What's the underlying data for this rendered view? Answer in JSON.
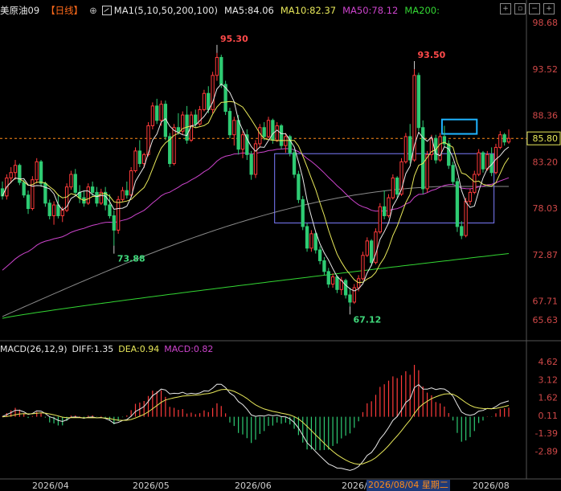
{
  "header": {
    "symbol": "美原油09",
    "period": "【日线】",
    "plus_icon": "plus-circle-icon",
    "ma_icon": "ma-settings-icon",
    "ma_config": "MA1(5,10,50,200,100)",
    "ma5": "MA5:84.06",
    "ma10": "MA10:82.37",
    "ma50": "MA50:78.12",
    "ma200": "MA200:"
  },
  "window_controls": [
    "+",
    "▫",
    "−",
    "+"
  ],
  "macd_header": {
    "name": "MACD(26,12,9)",
    "diff": "DIFF:1.35",
    "dea": "DEA:0.94",
    "macd": "MACD:0.82"
  },
  "colors": {
    "background": "#000000",
    "up": "#ff3a3a",
    "down": "#2ecb73",
    "ma5": "#e8e8e8",
    "ma10": "#e8e85a",
    "ma50": "#cc44cc",
    "ma100": "#8a8a8a",
    "ma200": "#33d633",
    "price_tag": "#e8e85a",
    "accent_orange": "#ff6a1a"
  },
  "chart_data": {
    "type": "candlestick",
    "price_axis": {
      "ticks": [
        "98.68",
        "93.52",
        "88.36",
        "83.20",
        "78.03",
        "72.87",
        "67.71",
        "65.63"
      ],
      "ylim": [
        65.63,
        98.68
      ]
    },
    "current_price": "85.80",
    "annotations": [
      {
        "label": "95.30",
        "value": 95.3,
        "kind": "high"
      },
      {
        "label": "73.88",
        "value": 73.88,
        "kind": "low"
      },
      {
        "label": "93.50",
        "value": 93.5,
        "kind": "high"
      },
      {
        "label": "67.12",
        "value": 67.12,
        "kind": "low"
      }
    ],
    "range_box": {
      "from": "2026/06/12",
      "to": "2026/08/21",
      "high": 84.1,
      "low": 76.4
    },
    "highlight_box": {
      "from": "2026/08/06",
      "to": "2026/08/17",
      "high": 87.9,
      "low": 86.3
    },
    "x_labels": [
      "2026/04",
      "2026/05",
      "2026/06",
      "2026/0",
      "2026/08"
    ],
    "cursor_label": "2026/08/04 星期二",
    "ma_series": [
      {
        "name": "MA5",
        "period": 5
      },
      {
        "name": "MA10",
        "period": 10
      },
      {
        "name": "MA50",
        "period": 50
      },
      {
        "name": "MA200",
        "period": 200
      },
      {
        "name": "MA100",
        "period": 100
      }
    ],
    "macd_axis": {
      "ticks": [
        "4.62",
        "3.12",
        "1.62",
        "0.11",
        "-1.39",
        "-2.89"
      ],
      "ylim": [
        -3.6,
        5.1
      ]
    },
    "start_date": "2026/03/16",
    "candles": [
      [
        80.2,
        81.0,
        79.0,
        79.4
      ],
      [
        79.4,
        81.8,
        79.0,
        81.4
      ],
      [
        81.4,
        82.6,
        80.8,
        82.0
      ],
      [
        82.0,
        83.4,
        81.2,
        82.8
      ],
      [
        82.8,
        83.0,
        80.6,
        80.9
      ],
      [
        80.9,
        81.2,
        79.2,
        79.5
      ],
      [
        79.5,
        80.0,
        77.4,
        78.0
      ],
      [
        78.0,
        81.6,
        77.8,
        81.2
      ],
      [
        81.2,
        83.6,
        80.8,
        83.2
      ],
      [
        83.2,
        83.4,
        80.4,
        80.8
      ],
      [
        80.8,
        81.0,
        78.2,
        78.6
      ],
      [
        78.6,
        79.0,
        76.8,
        77.2
      ],
      [
        77.2,
        78.8,
        76.2,
        78.4
      ],
      [
        78.4,
        79.6,
        76.9,
        77.2
      ],
      [
        77.2,
        78.2,
        76.5,
        77.8
      ],
      [
        77.8,
        80.8,
        77.6,
        80.4
      ],
      [
        80.4,
        82.2,
        80.1,
        81.8
      ],
      [
        81.8,
        82.4,
        79.4,
        79.8
      ],
      [
        79.8,
        80.6,
        78.6,
        79.2
      ],
      [
        79.2,
        80.0,
        78.2,
        78.6
      ],
      [
        78.6,
        80.8,
        78.4,
        80.4
      ],
      [
        80.4,
        81.0,
        79.4,
        79.8
      ],
      [
        79.8,
        80.4,
        78.2,
        78.6
      ],
      [
        78.6,
        80.2,
        78.4,
        79.8
      ],
      [
        79.8,
        80.4,
        77.8,
        78.4
      ],
      [
        78.4,
        79.6,
        76.9,
        77.2
      ],
      [
        77.2,
        77.8,
        73.88,
        75.6
      ],
      [
        75.6,
        79.4,
        75.2,
        79.0
      ],
      [
        79.0,
        80.4,
        78.8,
        80.0
      ],
      [
        80.0,
        81.0,
        79.1,
        79.5
      ],
      [
        79.5,
        82.6,
        79.2,
        82.2
      ],
      [
        82.2,
        84.8,
        82.0,
        84.4
      ],
      [
        84.4,
        85.6,
        82.6,
        83.0
      ],
      [
        83.0,
        84.2,
        82.5,
        84.0
      ],
      [
        84.0,
        87.6,
        83.8,
        87.2
      ],
      [
        87.2,
        89.8,
        86.8,
        89.4
      ],
      [
        89.4,
        90.2,
        87.4,
        87.8
      ],
      [
        87.8,
        90.0,
        87.2,
        89.6
      ],
      [
        89.6,
        90.0,
        85.6,
        86.0
      ],
      [
        86.0,
        86.4,
        82.6,
        83.0
      ],
      [
        83.0,
        87.4,
        82.8,
        87.0
      ],
      [
        87.0,
        88.6,
        86.2,
        86.6
      ],
      [
        86.6,
        88.8,
        86.2,
        88.4
      ],
      [
        88.4,
        89.4,
        85.2,
        85.6
      ],
      [
        85.6,
        88.8,
        85.4,
        88.4
      ],
      [
        88.4,
        89.0,
        87.0,
        87.4
      ],
      [
        87.4,
        89.4,
        87.2,
        89.0
      ],
      [
        89.0,
        91.2,
        88.8,
        90.8
      ],
      [
        90.8,
        91.6,
        88.6,
        89.0
      ],
      [
        89.0,
        93.2,
        88.6,
        92.8
      ],
      [
        92.8,
        95.3,
        92.2,
        94.8
      ],
      [
        94.8,
        95.1,
        91.4,
        91.8
      ],
      [
        91.8,
        92.2,
        88.4,
        88.8
      ],
      [
        88.8,
        89.2,
        85.8,
        86.2
      ],
      [
        86.2,
        88.2,
        85.0,
        87.8
      ],
      [
        87.8,
        88.4,
        84.0,
        84.6
      ],
      [
        84.6,
        86.6,
        83.6,
        86.2
      ],
      [
        86.2,
        86.8,
        83.4,
        84.0
      ],
      [
        84.0,
        84.4,
        81.2,
        81.8
      ],
      [
        81.8,
        85.6,
        81.4,
        85.2
      ],
      [
        85.2,
        87.4,
        84.8,
        87.0
      ],
      [
        87.0,
        87.6,
        85.6,
        86.0
      ],
      [
        86.0,
        88.2,
        85.8,
        87.8
      ],
      [
        87.8,
        88.0,
        85.2,
        85.6
      ],
      [
        85.6,
        87.6,
        85.4,
        87.2
      ],
      [
        87.2,
        87.4,
        84.6,
        85.0
      ],
      [
        85.0,
        86.4,
        84.2,
        86.0
      ],
      [
        86.0,
        86.2,
        83.8,
        84.2
      ],
      [
        84.2,
        84.6,
        81.4,
        81.8
      ],
      [
        81.8,
        82.2,
        78.6,
        79.0
      ],
      [
        79.0,
        79.4,
        75.6,
        76.0
      ],
      [
        76.0,
        76.4,
        73.2,
        73.6
      ],
      [
        73.6,
        75.6,
        73.2,
        75.2
      ],
      [
        75.2,
        75.4,
        73.0,
        73.4
      ],
      [
        73.4,
        73.8,
        71.8,
        72.2
      ],
      [
        72.2,
        72.6,
        70.6,
        71.0
      ],
      [
        71.0,
        71.4,
        69.2,
        69.6
      ],
      [
        69.6,
        70.8,
        69.2,
        70.4
      ],
      [
        70.4,
        70.6,
        68.6,
        69.0
      ],
      [
        69.0,
        70.4,
        68.4,
        70.0
      ],
      [
        70.0,
        70.2,
        68.0,
        68.4
      ],
      [
        68.4,
        69.2,
        67.12,
        67.6
      ],
      [
        67.6,
        69.6,
        67.4,
        69.2
      ],
      [
        69.2,
        70.6,
        68.8,
        70.2
      ],
      [
        70.2,
        73.2,
        70.0,
        72.8
      ],
      [
        72.8,
        74.8,
        72.6,
        74.4
      ],
      [
        74.4,
        74.6,
        71.6,
        72.0
      ],
      [
        72.0,
        75.8,
        71.8,
        75.4
      ],
      [
        75.4,
        78.6,
        75.2,
        78.2
      ],
      [
        78.2,
        80.0,
        76.8,
        77.2
      ],
      [
        77.2,
        79.6,
        77.0,
        79.2
      ],
      [
        79.2,
        81.8,
        79.0,
        81.4
      ],
      [
        81.4,
        81.6,
        79.2,
        79.6
      ],
      [
        79.6,
        83.6,
        79.4,
        83.2
      ],
      [
        83.2,
        86.4,
        83.0,
        86.0
      ],
      [
        86.0,
        87.4,
        83.0,
        83.4
      ],
      [
        83.4,
        93.5,
        83.2,
        92.8
      ],
      [
        92.8,
        93.1,
        86.6,
        87.0
      ],
      [
        87.0,
        87.8,
        79.6,
        80.2
      ],
      [
        80.2,
        84.4,
        79.8,
        84.0
      ],
      [
        84.0,
        86.2,
        83.4,
        85.8
      ],
      [
        85.8,
        86.2,
        83.0,
        83.4
      ],
      [
        83.4,
        86.4,
        83.2,
        86.0
      ],
      [
        86.0,
        87.2,
        84.8,
        85.2
      ],
      [
        85.2,
        85.6,
        82.4,
        82.8
      ],
      [
        82.8,
        83.2,
        80.6,
        81.0
      ],
      [
        81.0,
        81.4,
        75.4,
        76.0
      ],
      [
        76.0,
        76.6,
        74.6,
        75.0
      ],
      [
        75.0,
        79.2,
        74.8,
        78.8
      ],
      [
        78.8,
        80.2,
        78.4,
        79.8
      ],
      [
        79.8,
        82.2,
        79.6,
        81.8
      ],
      [
        81.8,
        84.6,
        81.6,
        84.2
      ],
      [
        84.2,
        84.4,
        82.0,
        82.4
      ],
      [
        82.4,
        84.4,
        82.2,
        84.0
      ],
      [
        84.0,
        84.8,
        81.6,
        82.0
      ],
      [
        82.0,
        85.2,
        81.8,
        84.8
      ],
      [
        84.8,
        86.6,
        84.6,
        86.2
      ],
      [
        86.2,
        86.4,
        85.0,
        85.4
      ],
      [
        85.4,
        86.8,
        85.2,
        85.8
      ]
    ]
  }
}
